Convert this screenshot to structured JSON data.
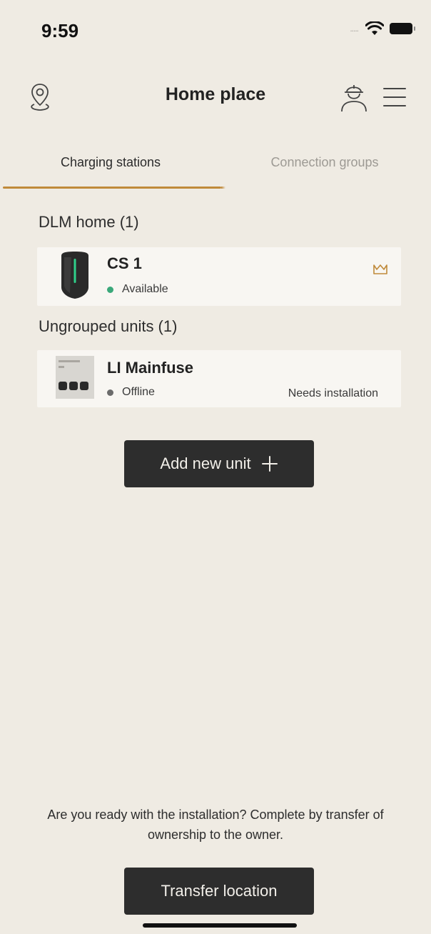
{
  "status_bar": {
    "time": "9:59",
    "signal": "....."
  },
  "header": {
    "title": "Home place",
    "left_icon": "location-pin-icon",
    "person_icon": "installer-icon",
    "menu_icon": "menu-icon"
  },
  "tabs": [
    {
      "label": "Charging stations",
      "active": true
    },
    {
      "label": "Connection groups",
      "active": false
    }
  ],
  "groups": [
    {
      "title": "DLM home (1)",
      "units": [
        {
          "name": "CS 1",
          "status": "Available",
          "status_color": "#3aa87a",
          "badge_icon": "crown-icon",
          "note": ""
        }
      ]
    },
    {
      "title": "Ungrouped units (1)",
      "units": [
        {
          "name": "LI Mainfuse",
          "status": "Offline",
          "status_color": "#6b6b6b",
          "note": "Needs installation"
        }
      ]
    }
  ],
  "add_button": {
    "label": "Add new unit",
    "icon": "plus-icon"
  },
  "footer": {
    "message": "Are you ready with the installation? Complete by transfer of ownership to the owner.",
    "transfer_button": "Transfer location"
  },
  "colors": {
    "background": "#efebe3",
    "accent": "#c08a3a",
    "button": "#2d2d2d",
    "available": "#3aa87a"
  }
}
